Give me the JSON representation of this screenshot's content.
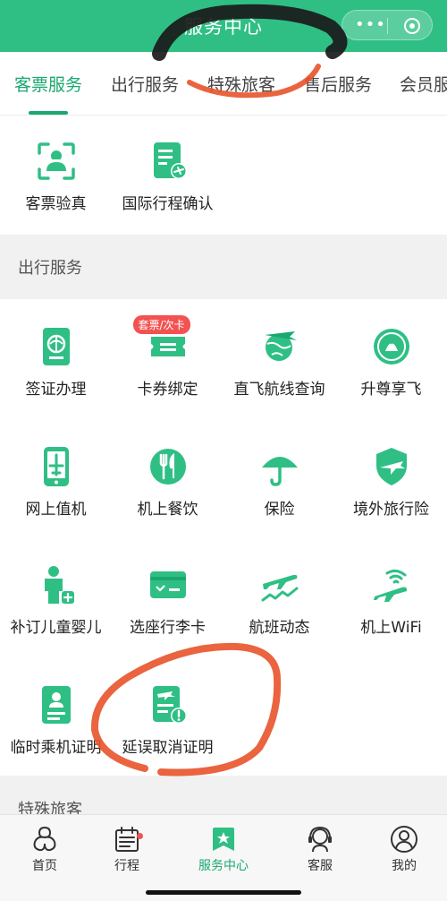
{
  "header": {
    "title": "服务中心",
    "menu_icon": "dots-icon",
    "close_icon": "target-icon"
  },
  "tabs": [
    {
      "label": "客票服务",
      "active": true
    },
    {
      "label": "出行服务",
      "active": false
    },
    {
      "label": "特殊旅客",
      "active": false
    },
    {
      "label": "售后服务",
      "active": false
    },
    {
      "label": "会员服务",
      "active": false
    }
  ],
  "ticket_services": {
    "items": [
      {
        "label": "客票验真",
        "icon": "verify-face-icon"
      },
      {
        "label": "国际行程确认",
        "icon": "itinerary-doc-icon"
      }
    ]
  },
  "travel_services": {
    "header": "出行服务",
    "items": [
      {
        "label": "签证办理",
        "icon": "passport-icon"
      },
      {
        "label": "卡券绑定",
        "icon": "ticket-card-icon",
        "badge": "套票/次卡"
      },
      {
        "label": "直飞航线查询",
        "icon": "globe-plane-icon"
      },
      {
        "label": "升尊享飞",
        "icon": "premium-badge-icon"
      },
      {
        "label": "网上值机",
        "icon": "mobile-checkin-icon"
      },
      {
        "label": "机上餐饮",
        "icon": "dining-icon"
      },
      {
        "label": "保险",
        "icon": "umbrella-icon"
      },
      {
        "label": "境外旅行险",
        "icon": "shield-plane-icon"
      },
      {
        "label": "补订儿童婴儿",
        "icon": "child-add-icon"
      },
      {
        "label": "选座行李卡",
        "icon": "seat-card-icon"
      },
      {
        "label": "航班动态",
        "icon": "flight-status-icon"
      },
      {
        "label": "机上WiFi",
        "icon": "wifi-plane-icon"
      },
      {
        "label": "临时乘机证明",
        "icon": "temp-id-icon"
      },
      {
        "label": "延误取消证明",
        "icon": "delay-cert-icon"
      }
    ]
  },
  "special_passengers": {
    "header": "特殊旅客"
  },
  "tabbar": {
    "items": [
      {
        "label": "首页",
        "icon": "home-icon",
        "active": false
      },
      {
        "label": "行程",
        "icon": "calendar-icon",
        "active": false,
        "dot": true
      },
      {
        "label": "服务中心",
        "icon": "service-center-icon",
        "active": true
      },
      {
        "label": "客服",
        "icon": "headset-icon",
        "active": false
      },
      {
        "label": "我的",
        "icon": "user-icon",
        "active": false
      }
    ]
  },
  "colors": {
    "brand": "#2fbf85",
    "active_text": "#1aa86f",
    "badge": "#f25252",
    "annotation_red": "#e8532a",
    "annotation_black": "#1a1a1a"
  }
}
